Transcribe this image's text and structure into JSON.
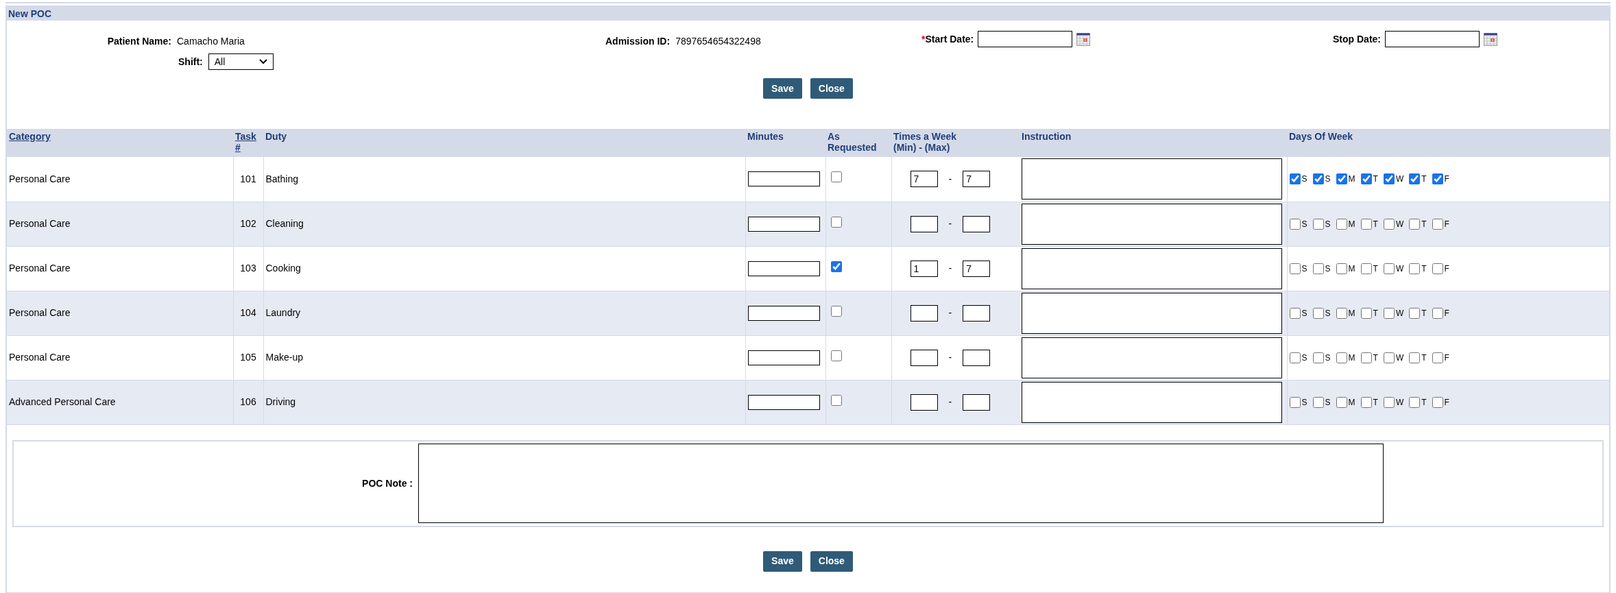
{
  "title": "New POC",
  "patient": {
    "label": "Patient Name:",
    "value": "Camacho Maria"
  },
  "admission": {
    "label": "Admission ID:",
    "value": "7897654654322498"
  },
  "start_date": {
    "required_mark": "*",
    "label": "Start Date:"
  },
  "stop_date": {
    "label": "Stop Date:"
  },
  "shift": {
    "label": "Shift:",
    "value": "All"
  },
  "top_buttons": [
    "Save",
    "Close"
  ],
  "table": {
    "columns": [
      {
        "label": "Category",
        "link": true
      },
      {
        "label": "Task #",
        "link": true
      },
      {
        "label": "Duty",
        "link": false
      },
      {
        "label": "Minutes",
        "link": false
      },
      {
        "label": "As Requested",
        "link": false
      },
      {
        "label": "Times a Week (Min) - (Max)",
        "link": false
      },
      {
        "label": "Instruction",
        "link": false
      },
      {
        "label": "Days Of Week",
        "link": false
      }
    ],
    "rows": [
      {
        "category": "Personal Care",
        "task": "101",
        "duty": "Bathing",
        "as_requested": false,
        "min": "7",
        "separator": "-",
        "max": "7",
        "days": [
          {
            "label": "S",
            "checked": true
          },
          {
            "label": "S",
            "checked": true
          },
          {
            "label": "M",
            "checked": true
          },
          {
            "label": "T",
            "checked": true
          },
          {
            "label": "W",
            "checked": true
          },
          {
            "label": "T",
            "checked": true
          },
          {
            "label": "F",
            "checked": true
          }
        ]
      },
      {
        "category": "Personal Care",
        "task": "102",
        "duty": "Cleaning",
        "as_requested": false,
        "separator": "-",
        "days": [
          {
            "label": "S",
            "checked": false
          },
          {
            "label": "S",
            "checked": false
          },
          {
            "label": "M",
            "checked": false
          },
          {
            "label": "T",
            "checked": false
          },
          {
            "label": "W",
            "checked": false
          },
          {
            "label": "T",
            "checked": false
          },
          {
            "label": "F",
            "checked": false
          }
        ]
      },
      {
        "category": "Personal Care",
        "task": "103",
        "duty": "Cooking",
        "as_requested": true,
        "min": "1",
        "separator": "-",
        "max": "7",
        "days": [
          {
            "label": "S",
            "checked": false
          },
          {
            "label": "S",
            "checked": false
          },
          {
            "label": "M",
            "checked": false
          },
          {
            "label": "T",
            "checked": false
          },
          {
            "label": "W",
            "checked": false
          },
          {
            "label": "T",
            "checked": false
          },
          {
            "label": "F",
            "checked": false
          }
        ]
      },
      {
        "category": "Personal Care",
        "task": "104",
        "duty": "Laundry",
        "as_requested": false,
        "separator": "-",
        "days": [
          {
            "label": "S",
            "checked": false
          },
          {
            "label": "S",
            "checked": false
          },
          {
            "label": "M",
            "checked": false
          },
          {
            "label": "T",
            "checked": false
          },
          {
            "label": "W",
            "checked": false
          },
          {
            "label": "T",
            "checked": false
          },
          {
            "label": "F",
            "checked": false
          }
        ]
      },
      {
        "category": "Personal Care",
        "task": "105",
        "duty": "Make-up",
        "as_requested": false,
        "separator": "-",
        "days": [
          {
            "label": "S",
            "checked": false
          },
          {
            "label": "S",
            "checked": false
          },
          {
            "label": "M",
            "checked": false
          },
          {
            "label": "T",
            "checked": false
          },
          {
            "label": "W",
            "checked": false
          },
          {
            "label": "T",
            "checked": false
          },
          {
            "label": "F",
            "checked": false
          }
        ]
      },
      {
        "category": "Advanced Personal Care",
        "task": "106",
        "duty": "Driving",
        "as_requested": false,
        "separator": "-",
        "days": [
          {
            "label": "S",
            "checked": false
          },
          {
            "label": "S",
            "checked": false
          },
          {
            "label": "M",
            "checked": false
          },
          {
            "label": "T",
            "checked": false
          },
          {
            "label": "W",
            "checked": false
          },
          {
            "label": "T",
            "checked": false
          },
          {
            "label": "F",
            "checked": false
          }
        ]
      }
    ]
  },
  "poc_note": {
    "label": "POC Note :"
  },
  "bottom_buttons": [
    "Save",
    "Close"
  ]
}
